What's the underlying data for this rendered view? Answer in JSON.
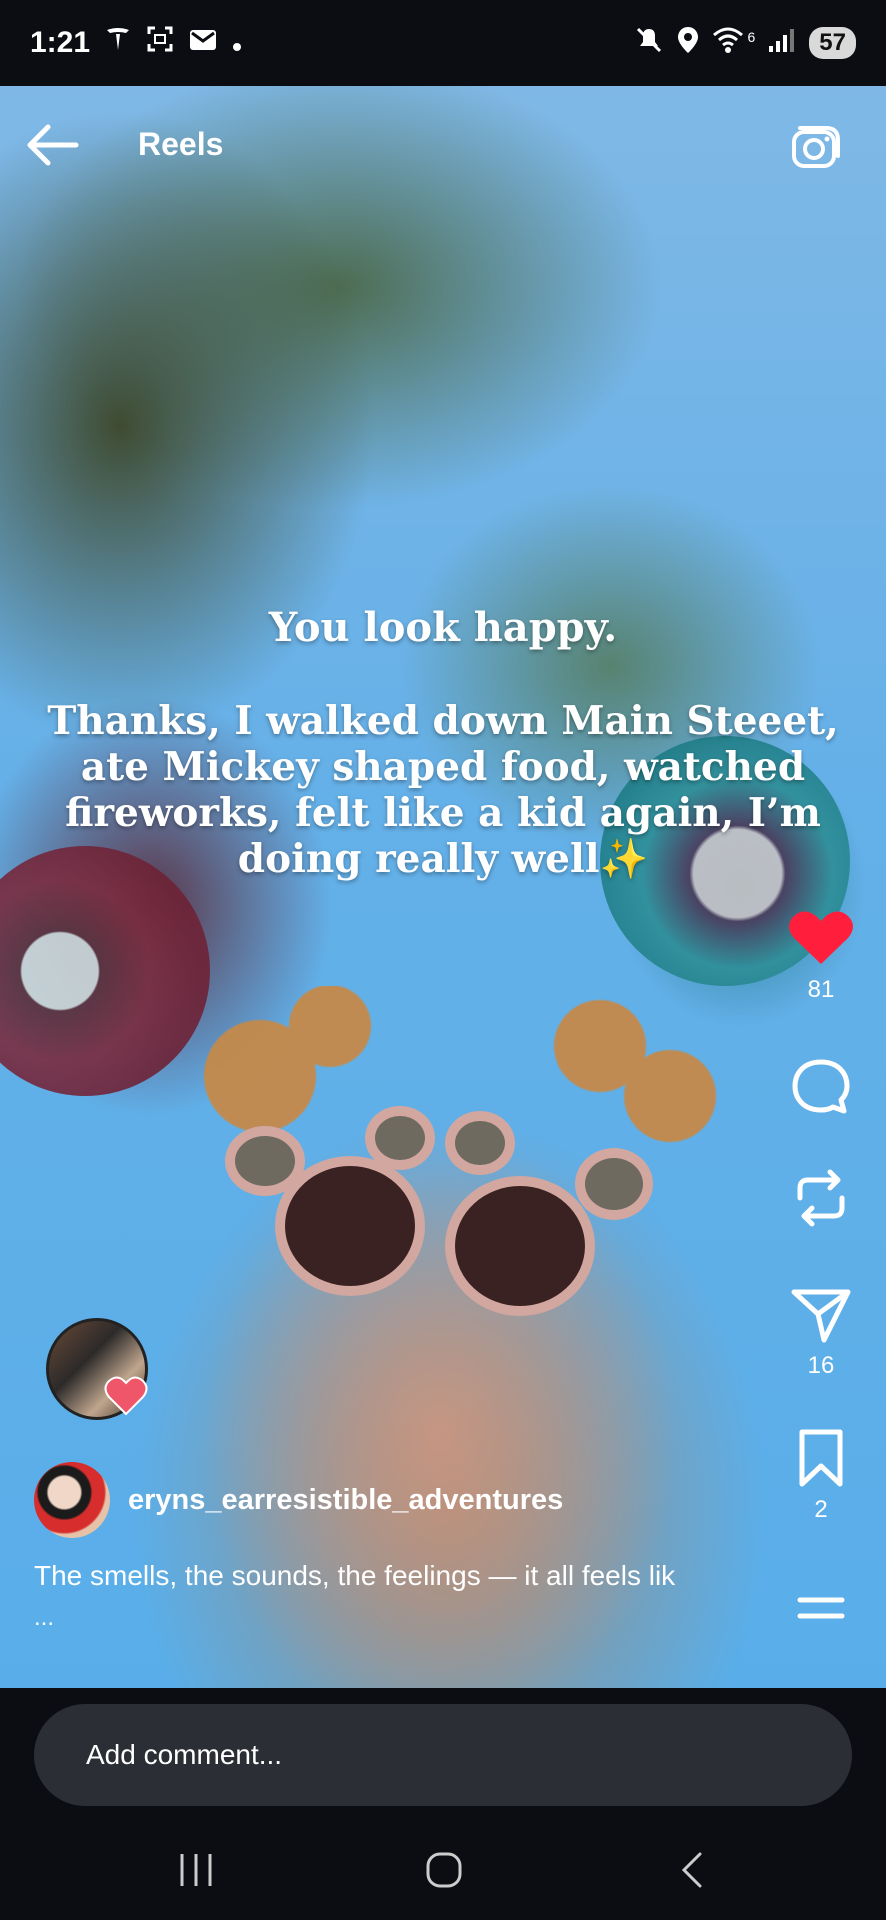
{
  "status_bar": {
    "time": "1:21",
    "battery": "57",
    "left_icons": [
      "tesla-icon",
      "screenshot-icon",
      "mail-icon",
      "dot-icon"
    ],
    "right_icons": [
      "mute-icon",
      "location-icon",
      "wifi-icon",
      "signal-icon"
    ],
    "wifi_label": "6"
  },
  "header": {
    "title": "Reels"
  },
  "video": {
    "overlay_line1": "You look happy.",
    "overlay_para": [
      "Thanks,  I walked down Main Steeet,",
      "ate Mickey shaped food, watched",
      "fireworks, felt like a kid again, I’m",
      "doing really well✨"
    ]
  },
  "actions": {
    "likes": "81",
    "shares": "16",
    "saves": "2",
    "like_color": "#ff1f3d"
  },
  "post": {
    "username": "eryns_earresistible_adventures",
    "caption": "The smells, the sounds, the feelings — it all feels lik",
    "caption_more": "..."
  },
  "comment": {
    "placeholder": "Add comment..."
  }
}
